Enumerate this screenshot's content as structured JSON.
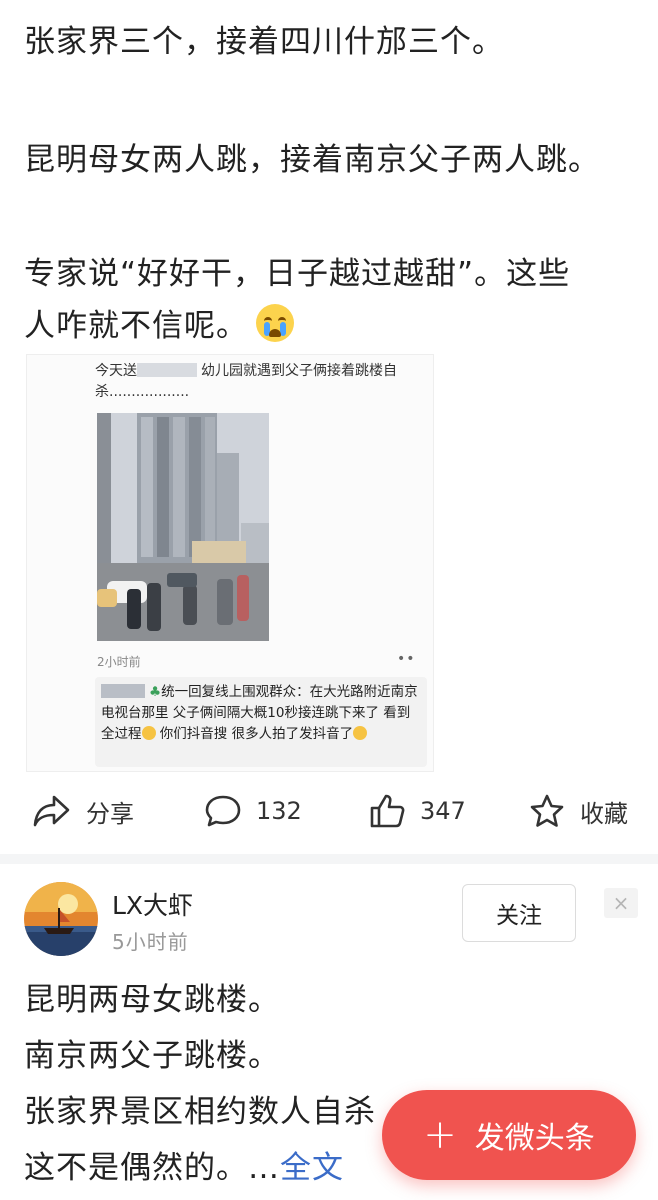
{
  "post": {
    "lines": [
      "张家界三个，接着四川什邡三个。",
      "昆明母女两人跳，接着南京父子两人跳。",
      "专家说“好好干，日子越过越甜”。这些人咋就不信呢。"
    ],
    "line3a": "专家说“好好干，日子越过越甜”。这些",
    "line3b": "人咋就不信呢。",
    "emoji": "crying-face"
  },
  "embed": {
    "caption_a": "今天送",
    "caption_b": "幼儿园就遇到父子俩接着跳楼自杀..................",
    "time": "2小时前",
    "menu": "••",
    "comment_author": "统一回复线上围观群众：",
    "comment_text_a": "在大光路附近",
    "comment_text_b": "南京电视台那里 父子俩间隔大概10秒接连跳下来了 看到全过程",
    "comment_text_c": "你们抖音搜 很多人拍了发抖音了"
  },
  "actions": {
    "share": "分享",
    "comments": "132",
    "likes": "347",
    "favorite": "收藏"
  },
  "second_post": {
    "username": "LX大虾",
    "time": "5小时前",
    "follow": "关注",
    "close": "×",
    "lines": [
      "昆明两母女跳楼。",
      "南京两父子跳楼。",
      "张家界景区相约数人自杀",
      "这不是偶然的。"
    ],
    "ellipsis": "…",
    "more": "全文"
  },
  "fab": {
    "plus": "+",
    "label": "发微头条"
  },
  "colors": {
    "accent": "#f0534f",
    "link": "#3b6cc8"
  }
}
